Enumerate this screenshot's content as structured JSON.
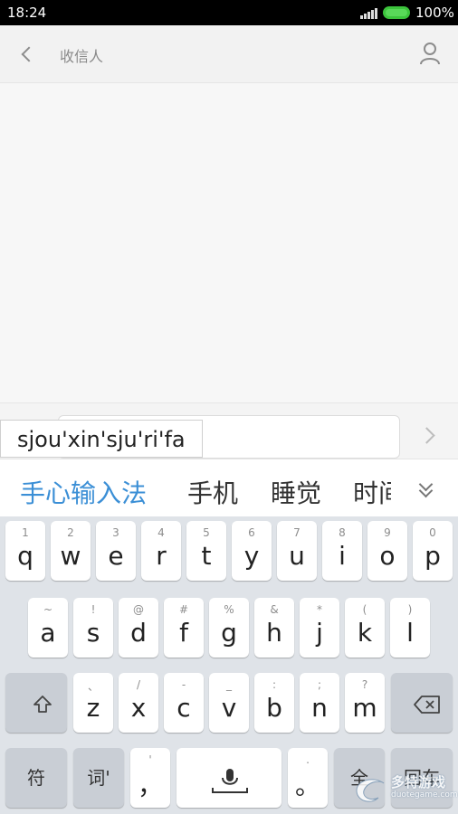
{
  "status_bar": {
    "time": "18:24",
    "battery": "100%"
  },
  "header": {
    "title": "收信人",
    "back_icon": "back-chevron",
    "contact_icon": "person-outline"
  },
  "compose": {
    "input_value": "",
    "send_icon": "chevron-right"
  },
  "ime": {
    "pinyin": "sjou'xin'sju'ri'fa",
    "candidates": [
      "手心输入法",
      "手机",
      "睡觉",
      "时间"
    ],
    "primary_color": "#3b8fd6"
  },
  "keyboard": {
    "row1": [
      {
        "hint": "1",
        "key": "q"
      },
      {
        "hint": "2",
        "key": "w"
      },
      {
        "hint": "3",
        "key": "e"
      },
      {
        "hint": "4",
        "key": "r"
      },
      {
        "hint": "5",
        "key": "t"
      },
      {
        "hint": "6",
        "key": "y"
      },
      {
        "hint": "7",
        "key": "u"
      },
      {
        "hint": "8",
        "key": "i"
      },
      {
        "hint": "9",
        "key": "o"
      },
      {
        "hint": "0",
        "key": "p"
      }
    ],
    "row2": [
      {
        "hint": "~",
        "key": "a"
      },
      {
        "hint": "!",
        "key": "s"
      },
      {
        "hint": "@",
        "key": "d"
      },
      {
        "hint": "#",
        "key": "f"
      },
      {
        "hint": "%",
        "key": "g"
      },
      {
        "hint": "&",
        "key": "h"
      },
      {
        "hint": "*",
        "key": "j"
      },
      {
        "hint": "(",
        "key": "k"
      },
      {
        "hint": ")",
        "key": "l"
      }
    ],
    "row3": [
      {
        "hint": "、",
        "key": "z"
      },
      {
        "hint": "/",
        "key": "x"
      },
      {
        "hint": "-",
        "key": "c"
      },
      {
        "hint": "_",
        "key": "v"
      },
      {
        "hint": ":",
        "key": "b"
      },
      {
        "hint": ";",
        "key": "n"
      },
      {
        "hint": "?",
        "key": "m"
      }
    ],
    "bottom": {
      "symbols": "符",
      "words": "词'",
      "comma_hint": "'",
      "comma": "，",
      "period_hint": ".",
      "period": "。",
      "full_width": "全",
      "enter": "回车"
    }
  },
  "watermark": {
    "text": "多特游戏",
    "sub": "duotegame.com"
  }
}
